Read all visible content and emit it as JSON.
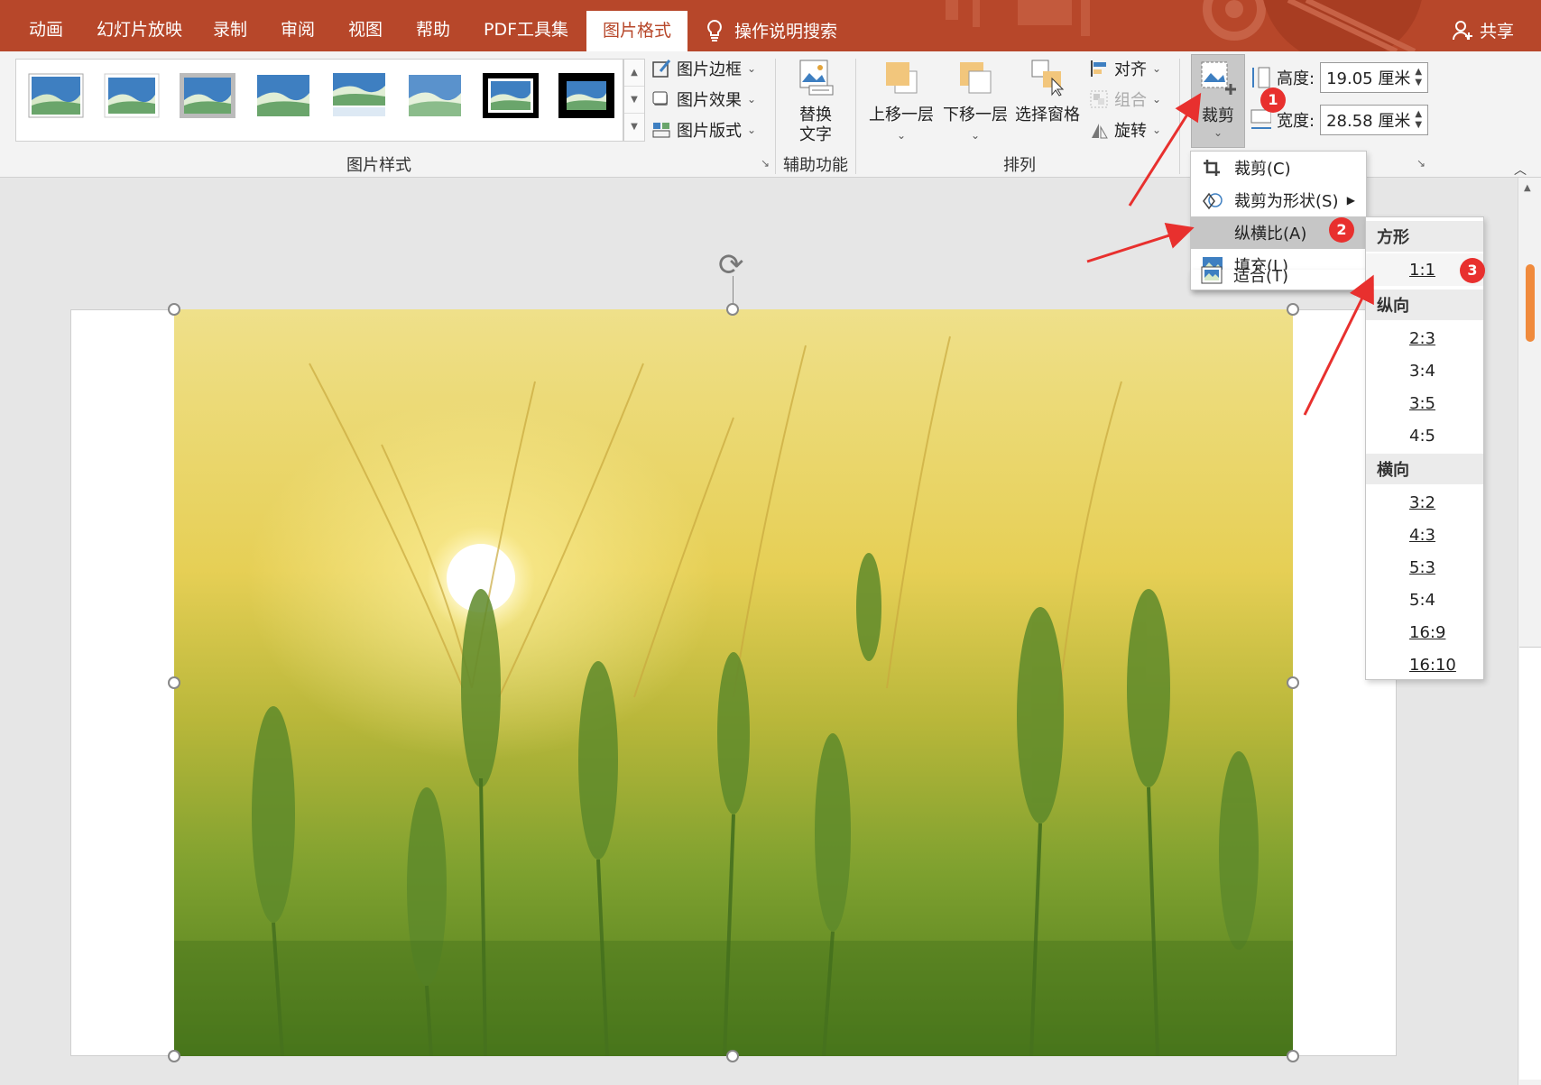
{
  "tabs": [
    {
      "label": "动画",
      "active": false
    },
    {
      "label": "幻灯片放映",
      "active": false
    },
    {
      "label": "录制",
      "active": false
    },
    {
      "label": "审阅",
      "active": false
    },
    {
      "label": "视图",
      "active": false
    },
    {
      "label": "帮助",
      "active": false
    },
    {
      "label": "PDF工具集",
      "active": false
    },
    {
      "label": "图片格式",
      "active": true
    }
  ],
  "tell_me": "操作说明搜索",
  "share": "共享",
  "ribbon": {
    "picture_styles_label": "图片样式",
    "border_label": "图片边框",
    "effects_label": "图片效果",
    "layout_label": "图片版式",
    "accessibility_group": "辅助功能",
    "alt_text_line1": "替换",
    "alt_text_line2": "文字",
    "arrange_group": "排列",
    "bring_forward": "上移一层",
    "send_backward": "下移一层",
    "selection_pane": "选择窗格",
    "align": "对齐",
    "group": "组合",
    "rotate": "旋转",
    "crop": "裁剪",
    "height_label": "高度:",
    "height_value": "19.05 厘米",
    "width_label": "宽度:",
    "width_value": "28.58 厘米"
  },
  "crop_menu": {
    "items": [
      {
        "label": "裁剪(C)",
        "icon": "crop-icon"
      },
      {
        "label": "裁剪为形状(S)",
        "icon": "shape-crop-icon"
      },
      {
        "label": "纵横比(A)",
        "icon": "none"
      },
      {
        "label": "填充(L)",
        "icon": "fill-icon"
      },
      {
        "label": "适合(T)",
        "icon": "fit-icon"
      }
    ]
  },
  "aspect_menu": {
    "square_header": "方形",
    "square": [
      "1:1"
    ],
    "portrait_header": "纵向",
    "portrait": [
      "2:3",
      "3:4",
      "3:5",
      "4:5"
    ],
    "landscape_header": "横向",
    "landscape": [
      "3:2",
      "4:3",
      "5:3",
      "5:4",
      "16:9",
      "16:10"
    ]
  },
  "badges": [
    "1",
    "2",
    "3"
  ],
  "colors": {
    "tab_bar": "#b7472a",
    "ribbon_bg": "#f3f3f3",
    "badge": "#e8302e",
    "arrow": "#e8302e"
  }
}
